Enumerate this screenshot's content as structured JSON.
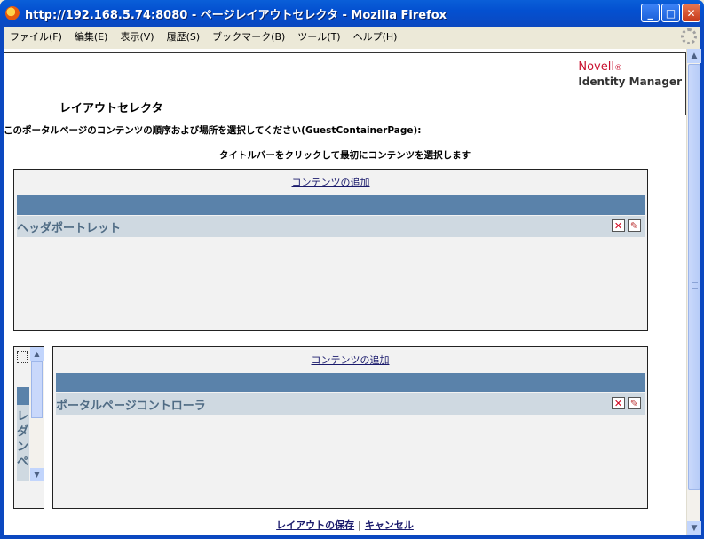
{
  "window": {
    "title": "http://192.168.5.74:8080 - ページレイアウトセレクタ - Mozilla Firefox",
    "minimize": "_",
    "maximize": "□",
    "close": "✕"
  },
  "menu": [
    "ファイル(F)",
    "編集(E)",
    "表示(V)",
    "履歴(S)",
    "ブックマーク(B)",
    "ツール(T)",
    "ヘルプ(H)"
  ],
  "header": {
    "brand": "Novell",
    "brand_mark": "®",
    "product": "Identity Manager",
    "title": "レイアウトセレクタ"
  },
  "instructions": {
    "line1": "このポータルページのコンテンツの順序および場所を選択してください(GuestContainerPage):",
    "line2": "タイトルバーをクリックして最初にコンテンツを選択します"
  },
  "top_container": {
    "add_link": "コンテンツの追加",
    "portlet_title": "ヘッダポートレット"
  },
  "narrow_container": {
    "portlet_text": "レダンペ"
  },
  "main_container": {
    "add_link": "コンテンツの追加",
    "portlet_title": "ポータルページコントローラ"
  },
  "footer": {
    "save": "レイアウトの保存",
    "separator": "|",
    "cancel": "キャンセル"
  },
  "icons": {
    "delete": "✕",
    "edit": "✎"
  }
}
